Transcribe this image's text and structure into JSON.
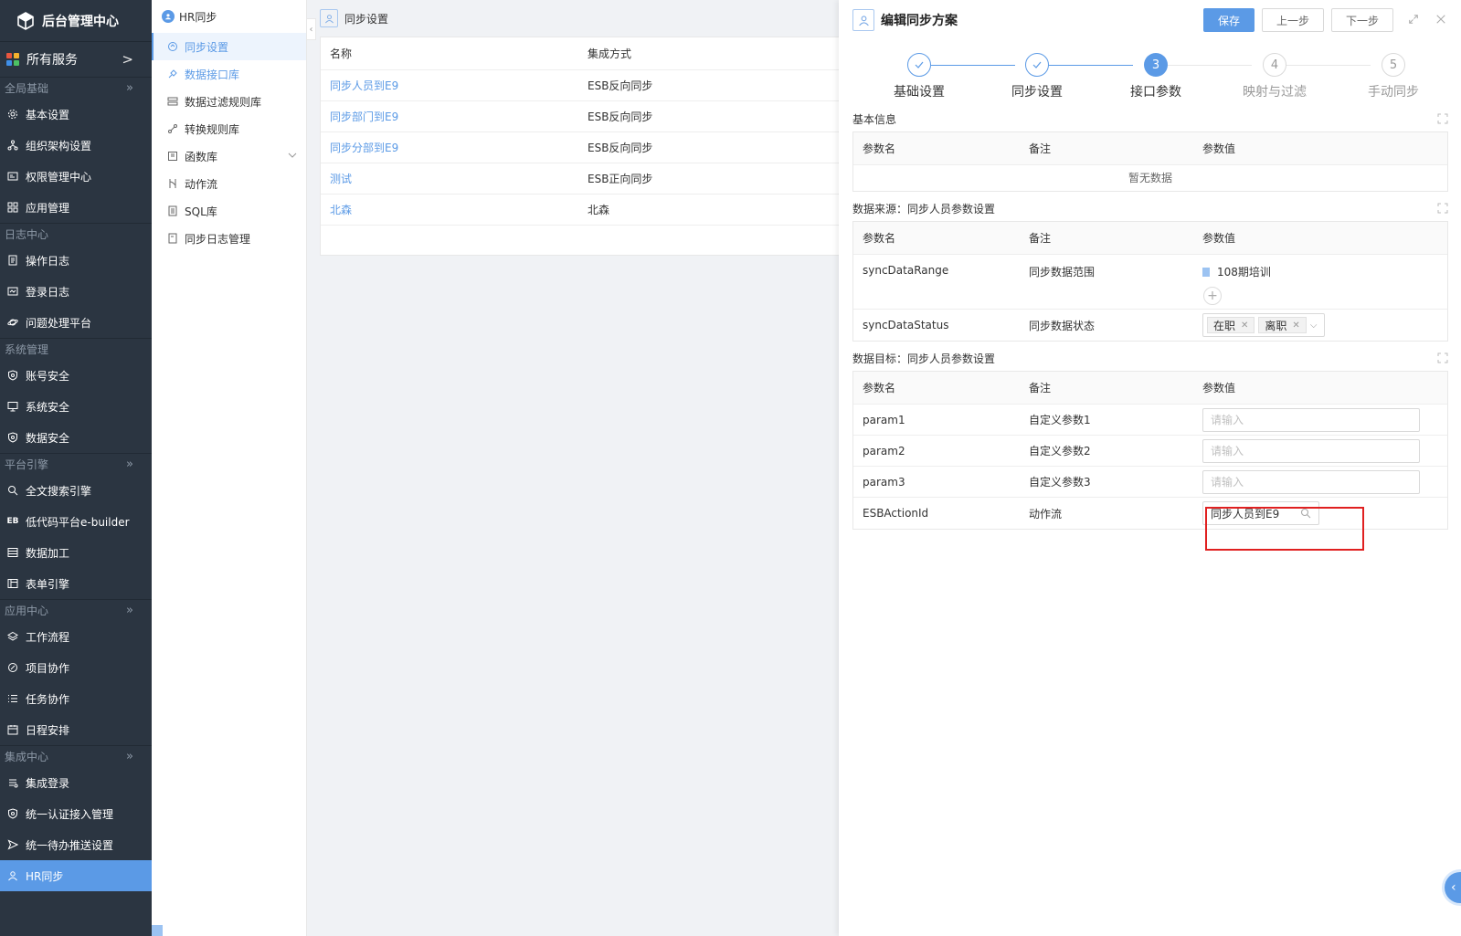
{
  "app": {
    "title": "后台管理中心"
  },
  "sidebar": {
    "all_services": "所有服务",
    "groups": [
      {
        "label": "全局基础",
        "items": [
          "基本设置",
          "组织架构设置",
          "权限管理中心",
          "应用管理"
        ]
      },
      {
        "label": "日志中心",
        "items": [
          "操作日志",
          "登录日志",
          "问题处理平台"
        ]
      },
      {
        "label": "系统管理",
        "items": [
          "账号安全",
          "系统安全",
          "数据安全"
        ]
      },
      {
        "label": "平台引擎",
        "items": [
          "全文搜索引擎",
          "低代码平台e-builder",
          "数据加工",
          "表单引擎"
        ]
      },
      {
        "label": "应用中心",
        "items": [
          "工作流程",
          "项目协作",
          "任务协作",
          "日程安排"
        ]
      },
      {
        "label": "集成中心",
        "items": [
          "集成登录",
          "统一认证接入管理",
          "统一待办推送设置",
          "HR同步"
        ]
      }
    ],
    "eb_badge": "EB"
  },
  "submenu": {
    "title": "HR同步",
    "items": [
      "同步设置",
      "数据接口库",
      "数据过滤规则库",
      "转换规则库",
      "函数库",
      "动作流",
      "SQL库",
      "同步日志管理"
    ]
  },
  "content": {
    "title": "同步设置",
    "columns": [
      "名称",
      "集成方式"
    ],
    "rows": [
      [
        "同步人员到E9",
        "ESB反向同步"
      ],
      [
        "同步部门到E9",
        "ESB反向同步"
      ],
      [
        "同步分部到E9",
        "ESB反向同步"
      ],
      [
        "测试",
        "ESB正向同步"
      ],
      [
        "北森",
        "北森"
      ]
    ]
  },
  "drawer": {
    "title": "编辑同步方案",
    "save": "保存",
    "prev": "上一步",
    "next": "下一步",
    "steps": [
      {
        "num": "",
        "label": "基础设置",
        "state": "done"
      },
      {
        "num": "",
        "label": "同步设置",
        "state": "done"
      },
      {
        "num": "3",
        "label": "接口参数",
        "state": "current"
      },
      {
        "num": "4",
        "label": "映射与过滤",
        "state": "todo"
      },
      {
        "num": "5",
        "label": "手动同步",
        "state": "todo"
      }
    ],
    "columns": [
      "参数名",
      "备注",
      "参数值"
    ],
    "sections": {
      "basic": {
        "title": "基本信息",
        "empty": "暂无数据"
      },
      "source": {
        "title": "数据来源：同步人员参数设置",
        "rows": [
          {
            "name": "syncDataRange",
            "note": "同步数据范围",
            "org": "108期培训"
          },
          {
            "name": "syncDataStatus",
            "note": "同步数据状态",
            "tags": [
              "在职",
              "离职"
            ]
          }
        ]
      },
      "target": {
        "title": "数据目标：同步人员参数设置",
        "rows": [
          {
            "name": "param1",
            "note": "自定义参数1",
            "placeholder": "请输入"
          },
          {
            "name": "param2",
            "note": "自定义参数2",
            "placeholder": "请输入"
          },
          {
            "name": "param3",
            "note": "自定义参数3",
            "placeholder": "请输入"
          },
          {
            "name": "ESBActionId",
            "note": "动作流",
            "value": "同步人员到E9"
          }
        ]
      }
    }
  },
  "colors": {
    "accent": "#5b9ae6",
    "sidebar_bg": "#2b3541",
    "highlight_box": "#e02020"
  }
}
